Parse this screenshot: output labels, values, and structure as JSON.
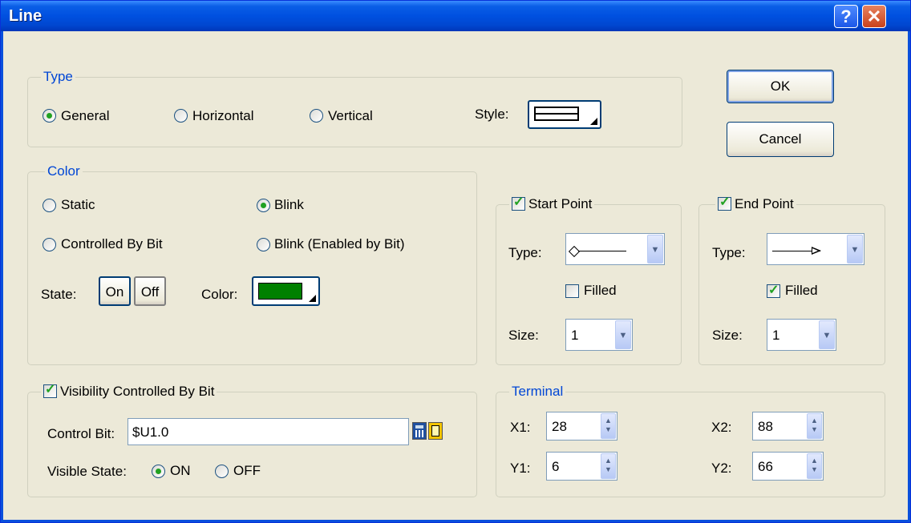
{
  "window": {
    "title": "Line",
    "help_symbol": "?",
    "close_symbol": "✕"
  },
  "buttons": {
    "ok": "OK",
    "cancel": "Cancel"
  },
  "type_group": {
    "legend": "Type",
    "options": [
      "General",
      "Horizontal",
      "Vertical"
    ],
    "selected": "General",
    "style_label": "Style:"
  },
  "color_group": {
    "legend": "Color",
    "options": [
      "Static",
      "Blink",
      "Controlled By Bit",
      "Blink (Enabled by Bit)"
    ],
    "selected": "Blink",
    "state_label": "State:",
    "state_on": "On",
    "state_off": "Off",
    "color_label": "Color:",
    "color_value": "#008000"
  },
  "start_point": {
    "legend": "Start Point",
    "checked": true,
    "type_label": "Type:",
    "filled_label": "Filled",
    "filled": false,
    "size_label": "Size:",
    "size": "1"
  },
  "end_point": {
    "legend": "End Point",
    "checked": true,
    "type_label": "Type:",
    "filled_label": "Filled",
    "filled": true,
    "size_label": "Size:",
    "size": "1"
  },
  "visibility": {
    "legend": "Visibility Controlled By Bit",
    "checked": true,
    "control_bit_label": "Control Bit:",
    "control_bit": "$U1.0",
    "visible_state_label": "Visible State:",
    "on_label": "ON",
    "off_label": "OFF",
    "selected": "ON"
  },
  "terminal": {
    "legend": "Terminal",
    "x1_label": "X1:",
    "x1": "28",
    "y1_label": "Y1:",
    "y1": "6",
    "x2_label": "X2:",
    "x2": "88",
    "y2_label": "Y2:",
    "y2": "66"
  },
  "icons": {
    "spin_up": "▲",
    "spin_down": "▼",
    "combo_arrow": "▼"
  },
  "colors": {
    "title_bar": "#0050e0",
    "group_legend": "#0046d5",
    "radio_dot": "#21a121",
    "dialog_bg": "#ece9d8"
  }
}
